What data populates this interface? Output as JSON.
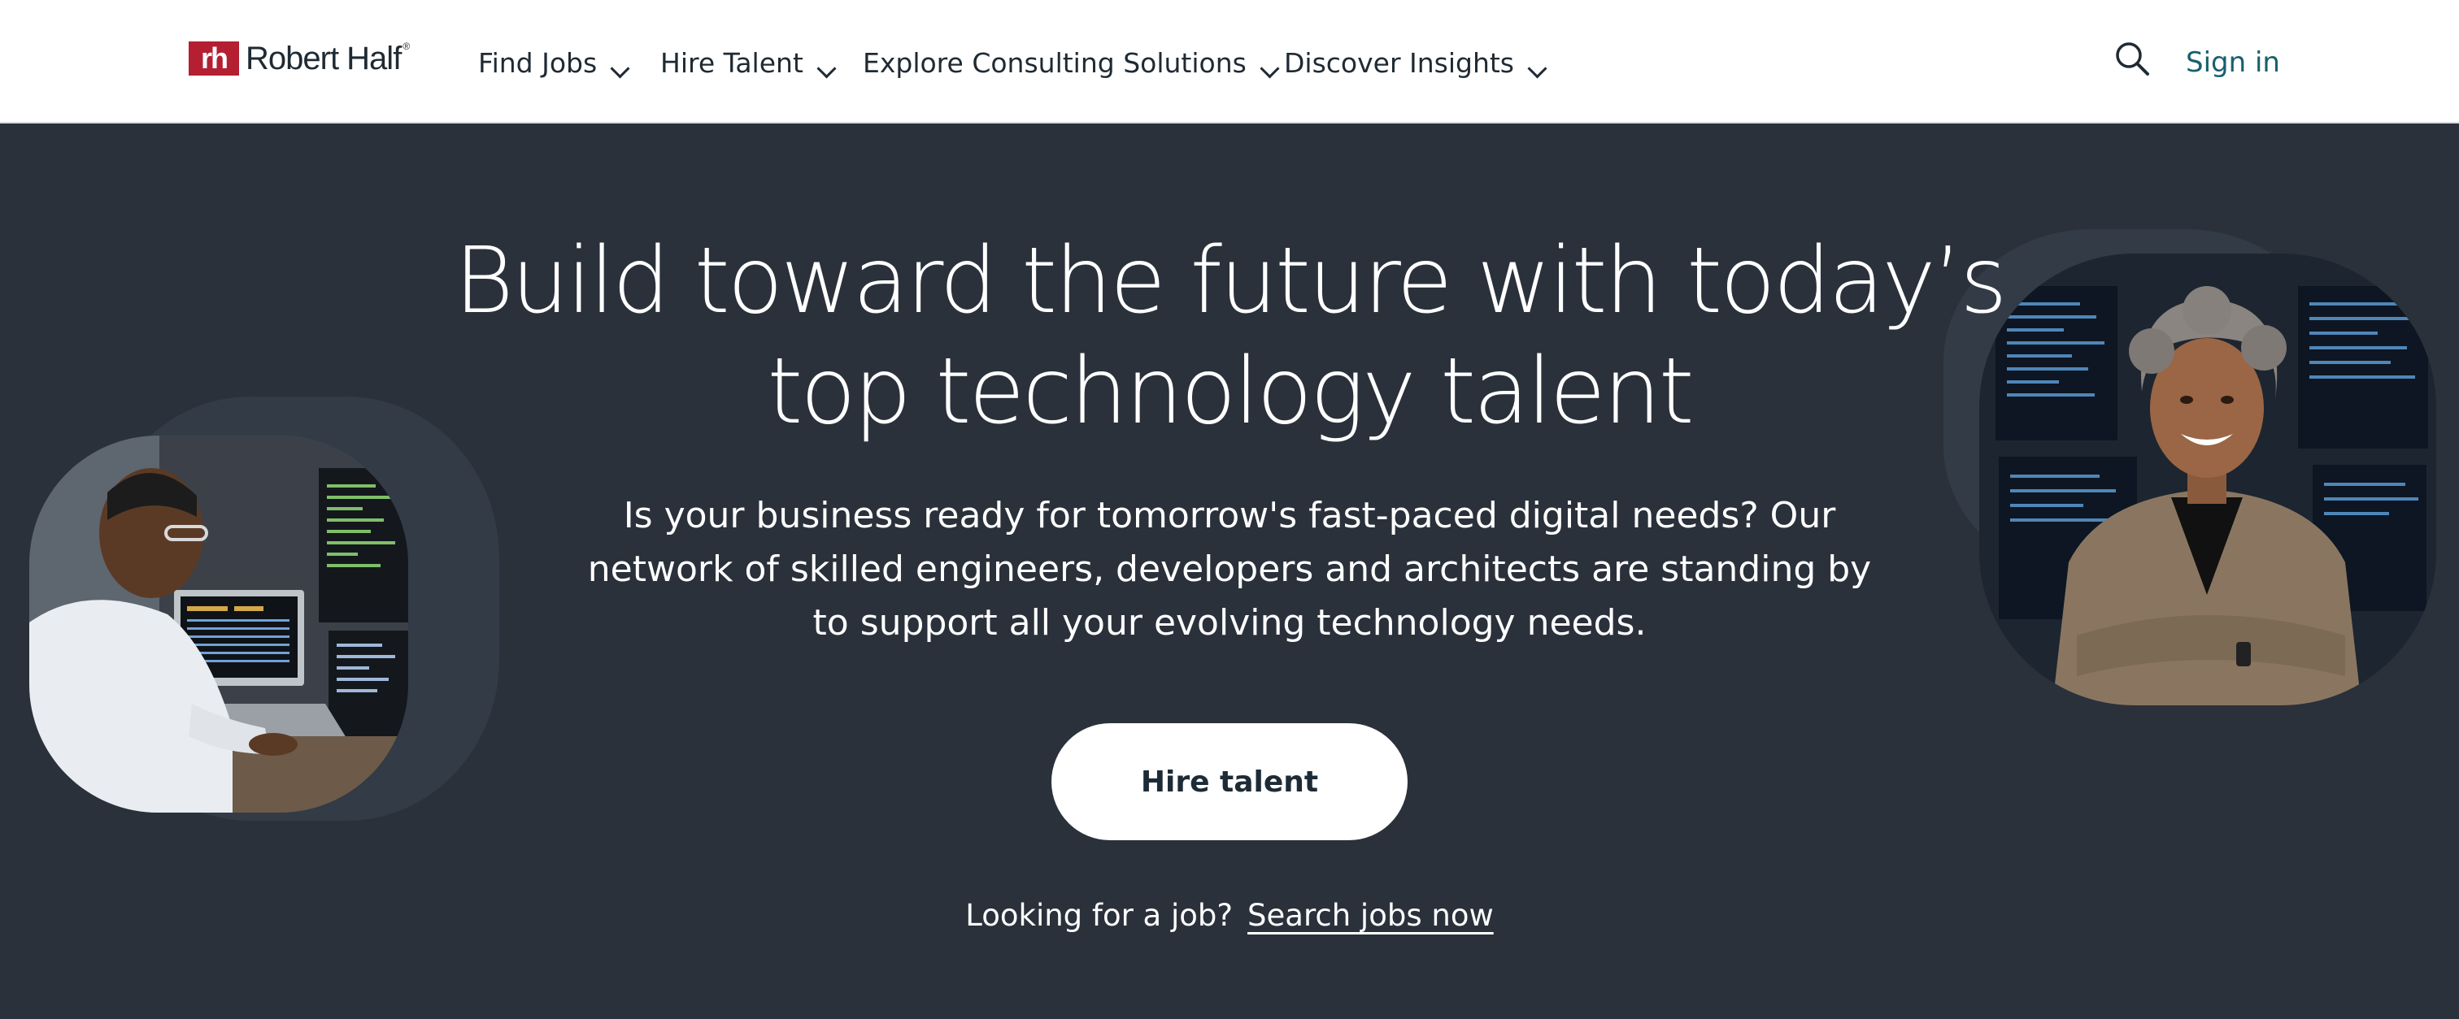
{
  "brand": {
    "logo_mark": "rh",
    "logo_text": "Robert Half",
    "logo_reg": "®"
  },
  "nav": {
    "items": [
      {
        "label": "Find Jobs"
      },
      {
        "label": "Hire Talent"
      },
      {
        "label": "Explore Consulting Solutions"
      },
      {
        "label": "Discover Insights"
      }
    ],
    "search_icon": "search-icon",
    "signin_label": "Sign in"
  },
  "hero": {
    "headline_line1": "Build toward the future with today’s",
    "headline_line2": "top technology talent",
    "subtext": "Is your business ready for tomorrow's fast-paced digital needs? Our network of skilled engineers, developers and architects are standing by to support all your evolving technology needs.",
    "cta_label": "Hire talent",
    "job_prompt": "Looking for a job?",
    "job_link": "Search jobs now"
  },
  "colors": {
    "brand_red": "#b41f32",
    "hero_bg": "#2a313b",
    "signin_teal": "#17606e"
  }
}
